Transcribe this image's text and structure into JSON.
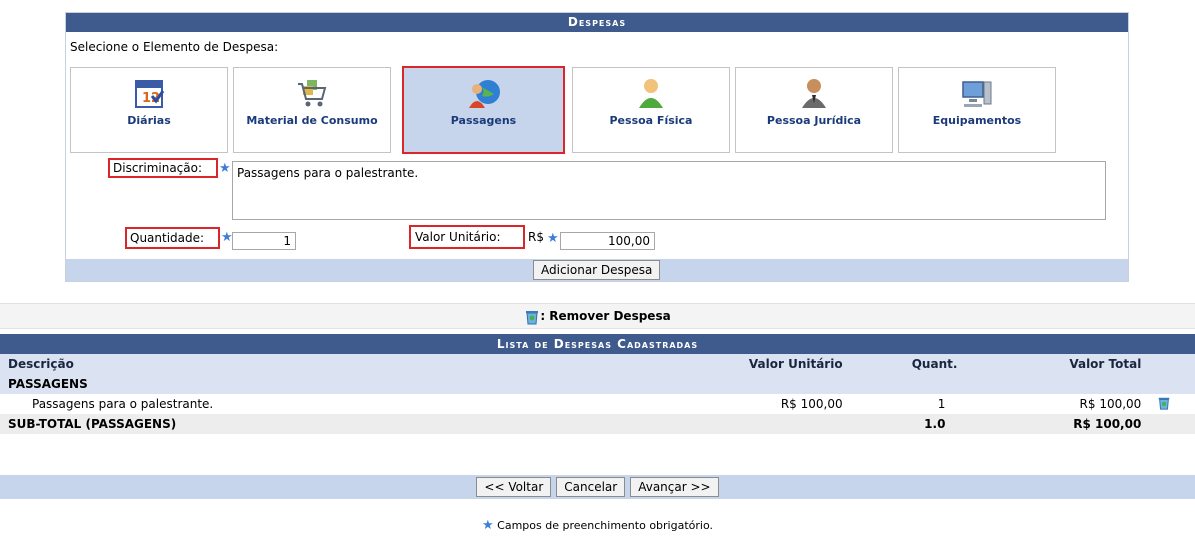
{
  "despesas": {
    "caption": "Despesas",
    "select_label": "Selecione o Elemento de Despesa:",
    "elements": [
      {
        "label": "Diárias",
        "icon": "calendar-icon"
      },
      {
        "label": "Material de Consumo",
        "icon": "shopping-cart-icon"
      },
      {
        "label": "Passagens",
        "icon": "globe-person-icon",
        "selected": true
      },
      {
        "label": "Pessoa Física",
        "icon": "person-icon"
      },
      {
        "label": "Pessoa Jurídica",
        "icon": "businessman-icon"
      },
      {
        "label": "Equipamentos",
        "icon": "computer-icon"
      }
    ],
    "discriminacao_label": "Discriminação:",
    "discriminacao_value": "Passagens para o palestrante.",
    "quantidade_label": "Quantidade:",
    "quantidade_value": "1",
    "valor_label": "Valor Unitário:",
    "currency": "R$",
    "valor_value": "100,00",
    "add_button": "Adicionar Despesa"
  },
  "legend": {
    "label": ": Remover Despesa",
    "icon": "trash-icon"
  },
  "list": {
    "caption": "Lista de Despesas Cadastradas",
    "headers": {
      "descricao": "Descrição",
      "valor_unitario": "Valor Unitário",
      "quant": "Quant.",
      "valor_total": "Valor Total"
    },
    "group": "PASSAGENS",
    "row": {
      "descricao": "Passagens para o palestrante.",
      "valor_unitario": "R$ 100,00",
      "quant": "1",
      "valor_total": "R$ 100,00"
    },
    "subtotal": {
      "label": "SUB-TOTAL (PASSAGENS)",
      "quant": "1.0",
      "valor_total": "R$ 100,00"
    }
  },
  "footer": {
    "voltar": "<< Voltar",
    "cancelar": "Cancelar",
    "avancar": "Avançar >>"
  },
  "note": "Campos de preenchimento obrigatório.",
  "colors": {
    "caption_bg": "#3f5a8d",
    "highlight": "#d9262b",
    "light_blue": "#c6d4ec"
  }
}
